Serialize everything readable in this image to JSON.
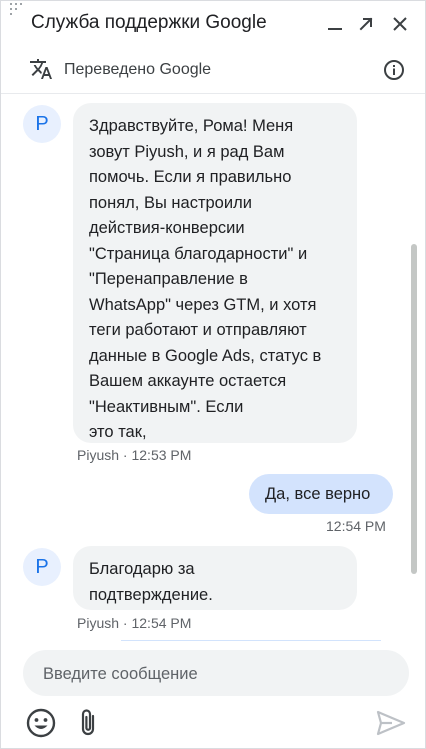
{
  "header": {
    "title": "Служба поддержки Google",
    "icons": [
      "drag-handle-icon",
      "minimize-icon",
      "open-in-new-icon",
      "close-icon"
    ]
  },
  "translation_bar": {
    "text": "Переведено Google",
    "icons": [
      "translate-icon",
      "info-icon"
    ]
  },
  "messages": [
    {
      "direction": "incoming",
      "avatar_letter": "P",
      "text": "Здравствуйте, Рома! Меня\nзовут Piyush, и я рад Вам\nпомочь. Если я правильно\nпонял, Вы настроили\nдействия-конверсии\n\"Страница благодарности\" и\n\"Перенаправление в\nWhatsApp\" через GTM, и хотя\nтеги работают и отправляют\nданные в Google Ads, статус в\nВашем аккаунте остается\n\"Неактивным\". Если\nэто так,",
      "sender": "Piyush",
      "separator": "·",
      "time": "12:53 PM"
    },
    {
      "direction": "outgoing",
      "text": "Да, все верно",
      "time": "12:54 PM"
    },
    {
      "direction": "incoming",
      "avatar_letter": "P",
      "text": "Благодарю за\nподтверждение.",
      "sender": "Piyush",
      "separator": "·",
      "time": "12:54 PM"
    }
  ],
  "composer": {
    "placeholder": "Введите сообщение",
    "icons": [
      "emoji-icon",
      "attach-icon",
      "send-icon"
    ]
  },
  "colors": {
    "accent": "#1a73e8",
    "incoming_bubble": "#f1f3f4",
    "outgoing_bubble": "#d3e3fd",
    "avatar_bg": "#e8f0fe",
    "meta_text": "#5f6368"
  }
}
